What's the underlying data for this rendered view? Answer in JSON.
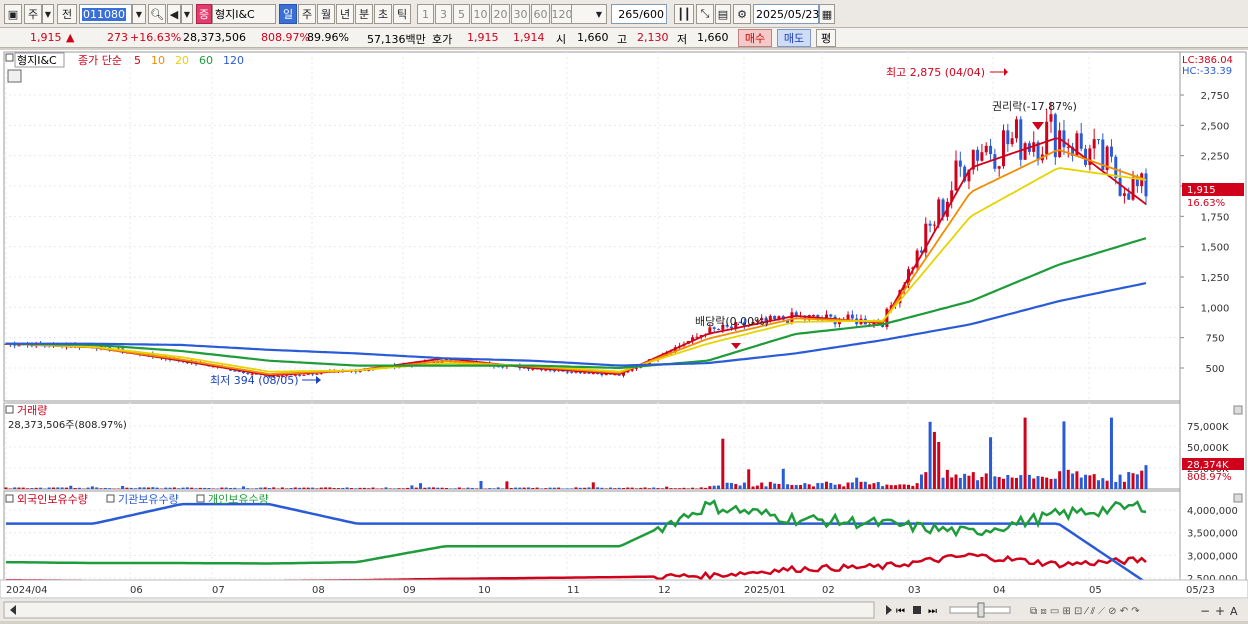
{
  "toolbar": {
    "type_label": "주",
    "prev_label": "전",
    "code_value": "011080",
    "logo_badge": "증",
    "stock_name": "형지I&C",
    "periods": [
      "일",
      "주",
      "월",
      "년",
      "분",
      "초",
      "틱"
    ],
    "active_period": "일",
    "intervals": [
      "1",
      "3",
      "5",
      "10",
      "20",
      "30",
      "60",
      "120"
    ],
    "count_value": "265",
    "count_total": "/600",
    "date_value": "2025/05/23"
  },
  "quote": {
    "price": "1,915",
    "arrow": "▲",
    "change": "273",
    "change_pct": "+16.63%",
    "volume": "28,373,506",
    "volume_ratio": "808.97%",
    "turnover": "89.96%",
    "amount": "57,136백만",
    "ask_label": "호가",
    "ask": "1,915",
    "bid": "1,914",
    "open_label": "시",
    "open": "1,660",
    "high_label": "고",
    "high": "2,130",
    "low_label": "저",
    "low": "1,660",
    "buy_label": "매수",
    "sell_label": "매도",
    "eval_label": "평"
  },
  "price_panel": {
    "title": "형지I&C",
    "legend_prefix": "종가 단순",
    "ma_labels": [
      "5",
      "10",
      "20",
      "60",
      "120"
    ],
    "ma_colors": [
      "#d0021b",
      "#f08c00",
      "#e8d200",
      "#1e9b3a",
      "#2a5bd7"
    ],
    "lc_label": "LC:386.04",
    "hc_label": "HC:-33.39",
    "y_ticks": [
      "2,750",
      "2,500",
      "2,250",
      "2,000",
      "1,750",
      "1,500",
      "1,250",
      "1,000",
      "750",
      "500"
    ],
    "current_price_tag": "1,915",
    "current_pct_tag": "16.63%",
    "ann_high": "최고 2,875 (04/04)",
    "ann_low": "최저 394 (08/05)",
    "ann_rights": "권리락(-17.87%)",
    "ann_dividend": "배당락(0.00%)"
  },
  "volume_panel": {
    "title": "거래량",
    "value_label": "28,373,506주(808.97%)",
    "y_ticks": [
      "75,000K",
      "50,000K",
      "25,000K"
    ],
    "current_tag": "28,374K",
    "current_pct_tag": "808.97%"
  },
  "holdings_panel": {
    "series": [
      "외국인보유수량",
      "기관보유수량",
      "개인보유수량"
    ],
    "colors": [
      "#d0021b",
      "#2a5bd7",
      "#1e9b3a"
    ],
    "y_ticks": [
      "4,000,000",
      "3,500,000",
      "3,000,000",
      "2,500,000"
    ]
  },
  "x_axis": {
    "labels": [
      "2024/04",
      "06",
      "07",
      "08",
      "09",
      "10",
      "11",
      "12",
      "2025/01",
      "02",
      "03",
      "04",
      "05",
      "05/23"
    ]
  },
  "chart_data": {
    "type": "line",
    "title": "형지I&C",
    "series": [
      {
        "name": "종가",
        "x": [
          "2024/04",
          "06",
          "07",
          "08",
          "09",
          "10",
          "11",
          "12",
          "2025/01",
          "02",
          "03",
          "04",
          "05",
          "05/23"
        ],
        "values": [
          700,
          680,
          560,
          430,
          480,
          560,
          500,
          440,
          800,
          920,
          880,
          2300,
          2450,
          1915
        ]
      },
      {
        "name": "5",
        "values": [
          700,
          670,
          560,
          440,
          480,
          580,
          500,
          450,
          780,
          930,
          870,
          2150,
          2400,
          1850
        ]
      },
      {
        "name": "10",
        "values": [
          700,
          670,
          570,
          450,
          480,
          560,
          510,
          460,
          740,
          910,
          880,
          1950,
          2300,
          2050
        ]
      },
      {
        "name": "20",
        "values": [
          700,
          675,
          590,
          470,
          480,
          540,
          520,
          470,
          700,
          880,
          890,
          1750,
          2150,
          2050
        ]
      },
      {
        "name": "60",
        "values": [
          700,
          690,
          640,
          560,
          520,
          520,
          520,
          500,
          560,
          780,
          860,
          1050,
          1350,
          1570
        ]
      },
      {
        "name": "120",
        "values": [
          700,
          700,
          690,
          650,
          620,
          580,
          560,
          520,
          540,
          620,
          730,
          860,
          1050,
          1200
        ]
      }
    ],
    "ylim": [
      350,
      2875
    ],
    "annotations": [
      {
        "label": "최고 2,875 (04/04)",
        "value": 2875
      },
      {
        "label": "최저 394 (08/05)",
        "value": 394
      }
    ]
  }
}
